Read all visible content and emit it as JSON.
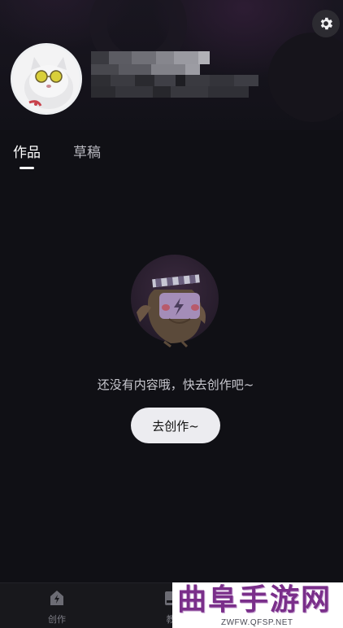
{
  "profile": {
    "settings_icon": "gear-icon",
    "avatar": "cat-with-sunglasses"
  },
  "tabs": [
    {
      "label": "作品",
      "active": true
    },
    {
      "label": "草稿",
      "active": false
    }
  ],
  "empty_state": {
    "illustration": "owl-clapperboard-icon",
    "message": "还没有内容哦，快去创作吧~",
    "button_label": "去创作~"
  },
  "bottom_nav": {
    "items": [
      {
        "label": "创作",
        "icon": "lightning-home-icon"
      },
      {
        "label": "教",
        "icon": "book-icon"
      }
    ]
  },
  "watermark": {
    "title": "曲阜手游网",
    "url": "ZWFW.QFSP.NET"
  },
  "colors": {
    "background": "#101015",
    "button": "#ececf0",
    "watermark_text": "#7a2f8a"
  }
}
